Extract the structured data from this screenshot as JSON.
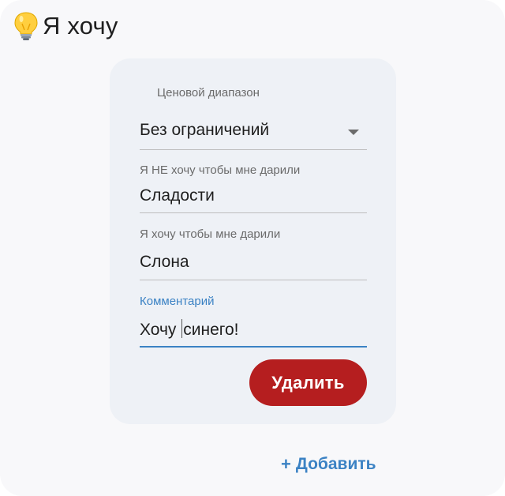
{
  "header": {
    "icon": "lightbulb-icon",
    "title": "Я хочу"
  },
  "form": {
    "price_range": {
      "label": "Ценовой диапазон",
      "value": "Без ограничений"
    },
    "not_want": {
      "label": "Я НЕ хочу чтобы мне дарили",
      "value": "Сладости"
    },
    "want": {
      "label": "Я хочу чтобы мне дарили",
      "value": "Слона"
    },
    "comment": {
      "label": "Комментарий",
      "value_before_caret": "Хочу ",
      "value_after_caret": "синего!"
    },
    "delete_label": "Удалить"
  },
  "add_button": {
    "icon": "plus-icon",
    "label": "Добавить"
  },
  "colors": {
    "accent": "#3b82c4",
    "danger": "#b51e1f",
    "card_bg": "#eef1f6"
  }
}
